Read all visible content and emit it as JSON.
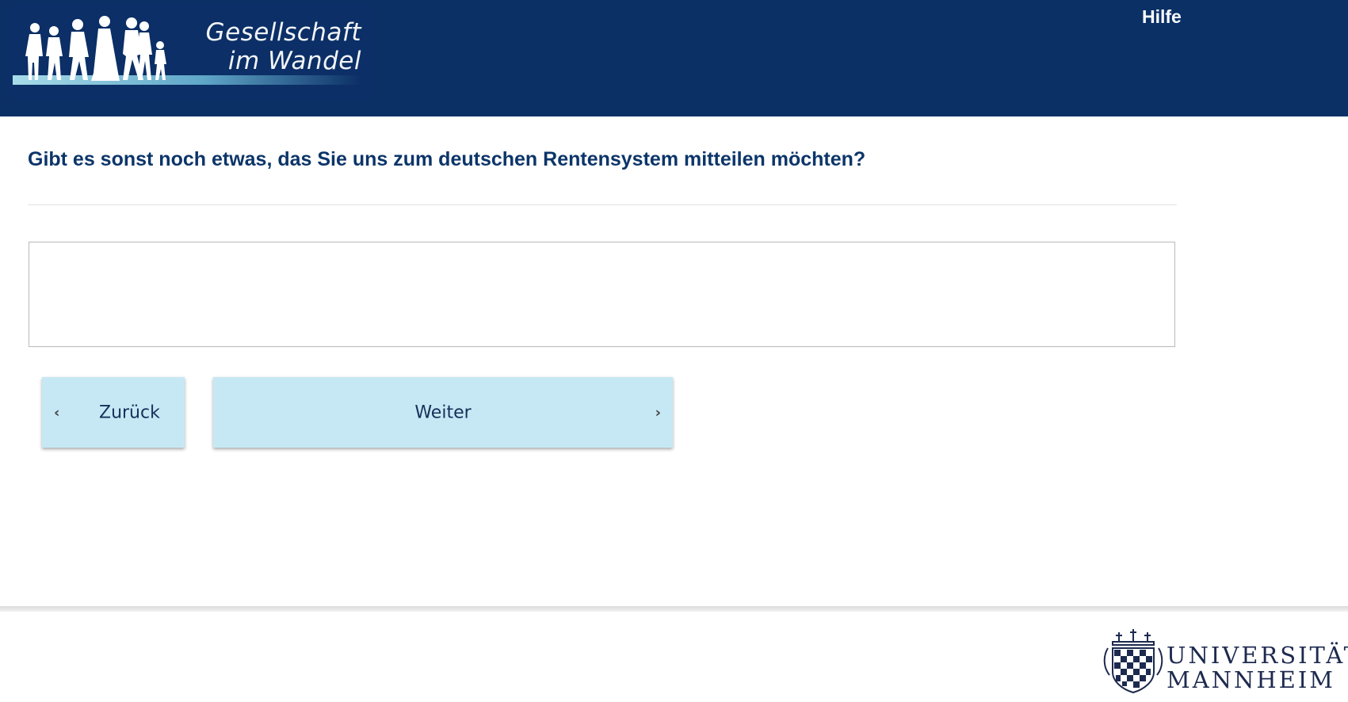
{
  "header": {
    "logo_line1": "Gesellschaft",
    "logo_line2": "im Wandel",
    "help_label": "Hilfe"
  },
  "question": {
    "text": "Gibt es sonst noch etwas, das Sie uns zum deutschen Rentensystem mitteilen möchten?",
    "answer_value": ""
  },
  "navigation": {
    "back_label": "Zurück",
    "next_label": "Weiter"
  },
  "footer": {
    "university_line1": "UNIVERSITÄT",
    "university_line2": "MANNHEIM"
  },
  "colors": {
    "header_bg": "#0a3066",
    "question_text": "#0c3569",
    "button_bg": "#c6e8f4"
  }
}
